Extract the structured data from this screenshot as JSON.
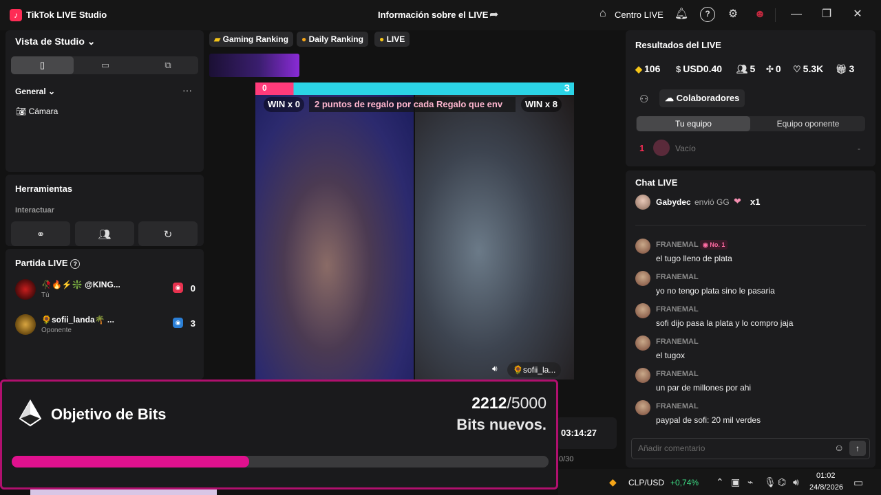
{
  "window": {
    "app_title": "TikTok LIVE Studio",
    "live_info": "Información sobre el LIVE",
    "centro_live": "Centro LIVE"
  },
  "left": {
    "studio_view_title": "Vista de Studio",
    "general_label": "General",
    "camera_label": "Cámara",
    "tools_title": "Herramientas",
    "interact_label": "Interactuar",
    "battle_title": "Partida LIVE",
    "players": [
      {
        "name": "🥀🔥⚡❇️ @KING...",
        "sub": "Tú",
        "score": "0",
        "badge_color": "#e8324f"
      },
      {
        "name": "🌻sofii_landa🌴 ...",
        "sub": "Oponente",
        "score": "3",
        "badge_color": "#2b7fd6"
      }
    ]
  },
  "center": {
    "chips": [
      "Gaming Ranking",
      "Daily Ranking",
      "LIVE"
    ],
    "video_top_left": "0",
    "video_top_right": "3",
    "marquee": "2 puntos de regalo por cada Regalo que env",
    "win_left": "WIN x 0",
    "win_right": "WIN x 8",
    "opponent_tag": "🌻sofii_la...",
    "timer": "03:14:27",
    "counter": "0/30"
  },
  "bits": {
    "title": "Objetivo de Bits",
    "current": "2212",
    "separator": "/",
    "goal": "5000",
    "subtitle": "Bits nuevos.",
    "progress": 0.442
  },
  "results": {
    "title": "Resultados del LIVE",
    "diamonds": "106",
    "usd": "USD0.40",
    "viewers": "5",
    "new_followers": "0",
    "likes": "5.3K",
    "gifts": "3",
    "collab_label": "Colaboradores",
    "tab_team": "Tu equipo",
    "tab_opponent": "Equipo oponente",
    "rank_1": "1",
    "rank_1_name": "Vacío",
    "rank_1_value": "-"
  },
  "chat": {
    "title": "Chat LIVE",
    "gift_user": "Gabydec",
    "gift_text": "envió GG",
    "gift_count": "x1",
    "badge": "No. 1",
    "messages": [
      {
        "user": "FRANEMAL",
        "text": "el tugo lleno de plata"
      },
      {
        "user": "FRANEMAL",
        "text": "yo no tengo plata sino le pasaria"
      },
      {
        "user": "FRANEMAL",
        "text": "sofi dijo pasa la plata y lo compro jaja"
      },
      {
        "user": "FRANEMAL",
        "text": "el tugox"
      },
      {
        "user": "FRANEMAL",
        "text": "un par de millones por ahi"
      },
      {
        "user": "FRANEMAL",
        "text": "paypal de sofi: 20 mil verdes"
      }
    ],
    "comment_placeholder": "Añadir comentario"
  },
  "taskbar": {
    "currency": "CLP/USD",
    "change": "+0,74%",
    "time": "01:02",
    "date": "24/8/2026"
  },
  "colors": {
    "accent_pink": "#e0118e",
    "border_magenta": "#b0106e",
    "positive_green": "#3ddc84"
  }
}
